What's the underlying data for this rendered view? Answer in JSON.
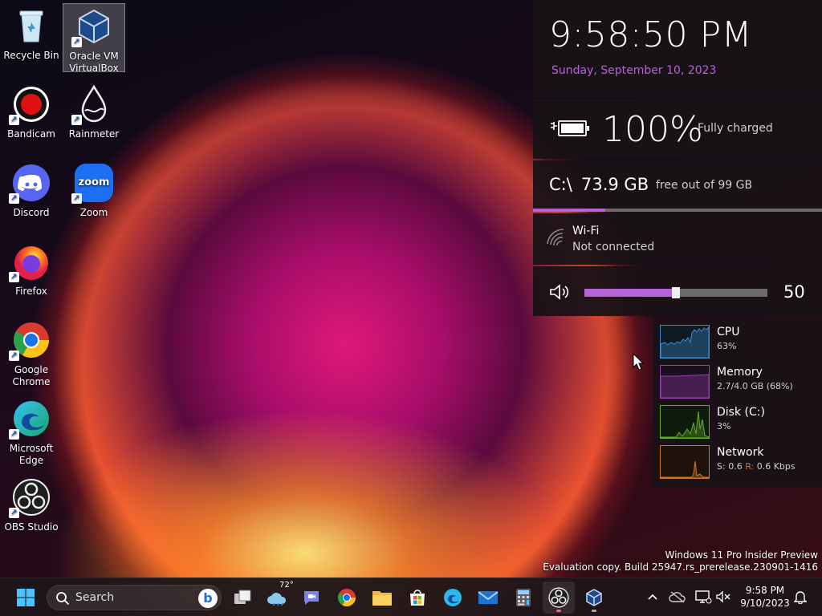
{
  "desktop": {
    "icons": [
      {
        "label": "Recycle Bin",
        "icon": "recycle-bin-icon"
      },
      {
        "label": "Oracle VM\nVirtualBox",
        "icon": "virtualbox-icon"
      },
      {
        "label": "Bandicam",
        "icon": "bandicam-icon"
      },
      {
        "label": "Rainmeter",
        "icon": "rainmeter-icon"
      },
      {
        "label": "Discord",
        "icon": "discord-icon"
      },
      {
        "label": "Zoom",
        "icon": "zoom-icon",
        "glyph": "zoom"
      },
      {
        "label": "Firefox",
        "icon": "firefox-icon"
      },
      {
        "label": "Google\nChrome",
        "icon": "chrome-icon"
      },
      {
        "label": "Microsoft\nEdge",
        "icon": "edge-icon"
      },
      {
        "label": "OBS Studio",
        "icon": "obs-icon"
      }
    ]
  },
  "clock": {
    "time": "9:58:50 PM",
    "date": "Sunday, September 10, 2023"
  },
  "battery": {
    "percent_text": "100%",
    "status": "Fully charged",
    "level": 1.0
  },
  "disk": {
    "drive": "C:\\",
    "free": "73.9 GB",
    "total_text": "free out of 99 GB",
    "used_fraction": 0.25
  },
  "wifi": {
    "name": "Wi-Fi",
    "status": "Not connected"
  },
  "volume": {
    "value_text": "50",
    "level": 0.5
  },
  "resources": [
    {
      "name": "CPU",
      "value": "63%",
      "color": "#3a8fd0"
    },
    {
      "name": "Memory",
      "value": "2.7/4.0 GB (68%)",
      "color": "#9b3fb0"
    },
    {
      "name": "Disk (C:)",
      "value": "3%",
      "color": "#5fae2a"
    },
    {
      "name": "Network",
      "value_prefix_s": "S:",
      "value_s": "0.6",
      "value_prefix_r": "R:",
      "value_r": "0.6 Kbps",
      "color": "#d0742a"
    }
  ],
  "watermark": {
    "line1": "Windows 11 Pro Insider Preview",
    "line2": "Evaluation copy. Build 25947.rs_prerelease.230901-1416"
  },
  "taskbar": {
    "search_label": "Search",
    "bing_glyph": "b",
    "weather_temp": "72°",
    "apps": [
      "task-view",
      "widgets",
      "teams",
      "chrome",
      "file-explorer",
      "store",
      "edge",
      "mail",
      "calculator",
      "obs",
      "virtualbox"
    ],
    "clock_time": "9:58 PM",
    "clock_date": "9/10/2023"
  },
  "colors": {
    "accent": "#b463d9",
    "panel": "#181216"
  }
}
